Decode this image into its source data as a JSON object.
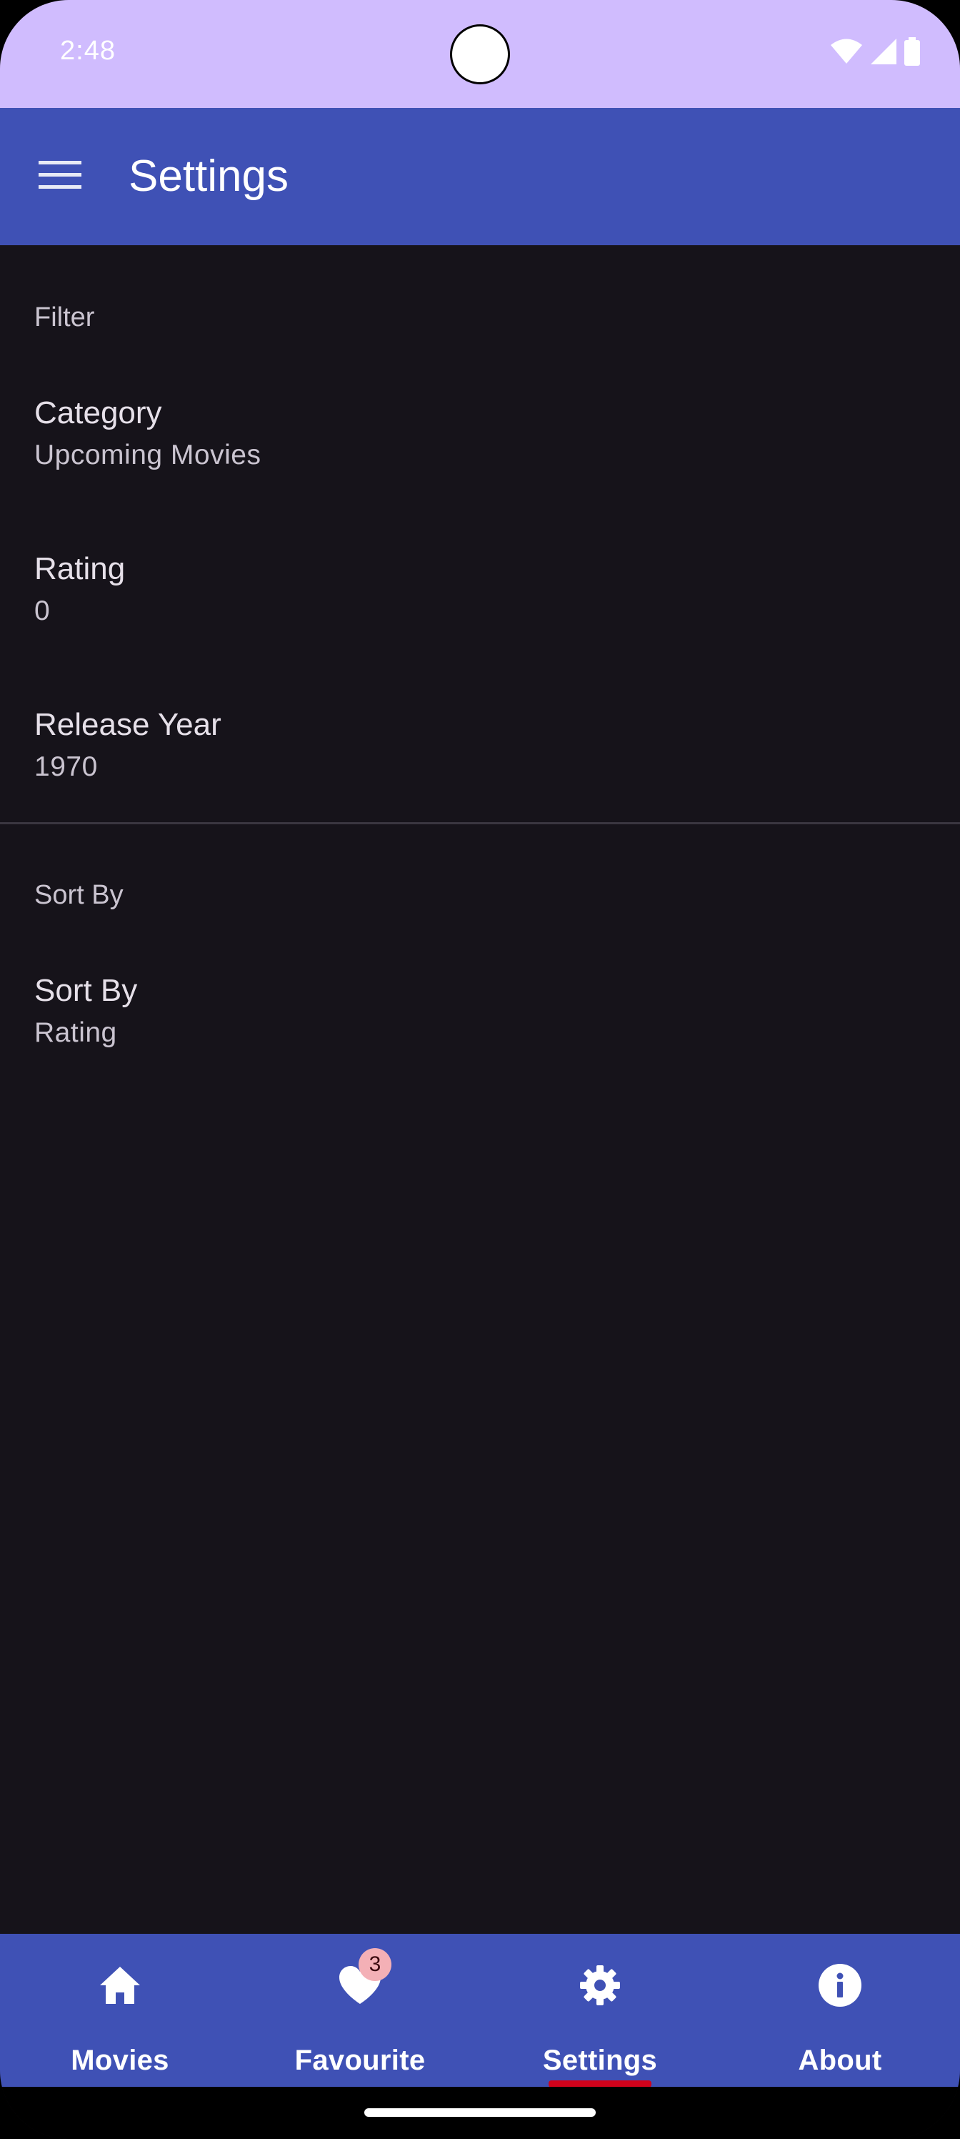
{
  "status_bar": {
    "time": "2:48",
    "icons": [
      "wifi-icon",
      "signal-icon",
      "battery-icon"
    ],
    "color": "#d0bcfe"
  },
  "app_bar": {
    "title": "Settings",
    "menu_icon": "hamburger-menu-icon",
    "color": "#3f51b5"
  },
  "preferences": {
    "filter": {
      "category_label": "Filter",
      "items": [
        {
          "title": "Category",
          "summary": "Upcoming Movies"
        },
        {
          "title": "Rating",
          "summary": "0"
        },
        {
          "title": "Release Year",
          "summary": "1970"
        }
      ]
    },
    "sort": {
      "category_label": "Sort By",
      "items": [
        {
          "title": "Sort By",
          "summary": "Rating"
        }
      ]
    }
  },
  "bottom_nav": {
    "items": [
      {
        "label": "Movies",
        "icon": "home-icon"
      },
      {
        "label": "Favourite",
        "icon": "heart-icon",
        "badge": "3"
      },
      {
        "label": "Settings",
        "icon": "gear-icon",
        "selected": true
      },
      {
        "label": "About",
        "icon": "info-icon"
      }
    ],
    "indicator_color": "#d0021b",
    "badge_color": "#f4b0b6"
  }
}
